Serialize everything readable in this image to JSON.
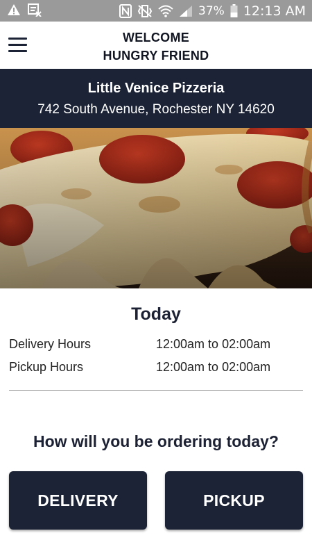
{
  "status_bar": {
    "battery": "37%",
    "time": "12:13 AM",
    "icons": [
      "warning-icon",
      "image-off-icon",
      "nfc-icon",
      "vibrate-icon",
      "wifi-icon",
      "signal-icon",
      "battery-icon"
    ]
  },
  "header": {
    "line1": "WELCOME",
    "line2": "HUNGRY FRIEND",
    "menu_icon": "hamburger-menu-icon"
  },
  "restaurant": {
    "name": "Little Venice Pizzeria",
    "address": "742 South Avenue, Rochester NY 14620"
  },
  "hours": {
    "title": "Today",
    "rows": [
      {
        "label": "Delivery Hours",
        "value": "12:00am to 02:00am"
      },
      {
        "label": "Pickup Hours",
        "value": "12:00am to 02:00am"
      }
    ]
  },
  "ordering": {
    "question": "How will you be ordering today?",
    "delivery_label": "DELIVERY",
    "pickup_label": "PICKUP"
  },
  "colors": {
    "navy": "#1c2336",
    "status_bar": "#9a9a9a",
    "white": "#ffffff"
  }
}
